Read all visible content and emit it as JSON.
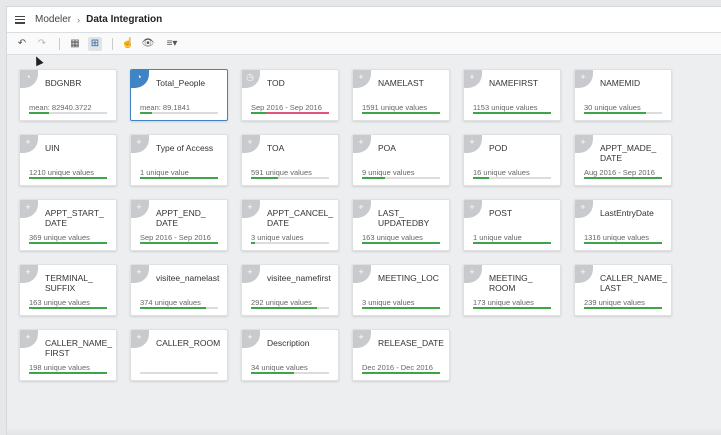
{
  "header": {
    "menu_icon": "hamburger-menu-icon",
    "breadcrumb_root": "Modeler",
    "breadcrumb_separator": "›",
    "breadcrumb_current": "Data Integration"
  },
  "toolbar": {
    "buttons": [
      {
        "icon": "undo-icon",
        "glyph": "↶"
      },
      {
        "icon": "redo-icon",
        "glyph": "↷"
      },
      {
        "icon": "table-view-icon",
        "glyph": "▦"
      },
      {
        "icon": "grid-view-icon",
        "glyph": "⊞"
      },
      {
        "icon": "join-hand-icon",
        "glyph": "☝"
      },
      {
        "icon": "eye-preview-icon",
        "glyph": "👁"
      },
      {
        "icon": "sort-list-icon",
        "glyph": "≡▾"
      }
    ]
  },
  "colors": {
    "accent": "#3f85c6",
    "bar_green": "#3da547",
    "bar_pink": "#e2547d"
  },
  "cards": [
    {
      "name": "BDGNBR",
      "stat": "mean: 82940.3722",
      "icon": "numeric-gauge-icon",
      "glyph": "◔",
      "fill": 0.25,
      "bar": "green"
    },
    {
      "name": "Total_People",
      "stat": "mean: 89.1841",
      "icon": "numeric-gauge-icon",
      "glyph": "◔",
      "fill": 0.15,
      "bar": "green",
      "selected": true
    },
    {
      "name": "TOD",
      "stat": "Sep 2016 - Sep 2016",
      "icon": "clock-icon",
      "glyph": "◷",
      "fill": 1.0,
      "bar": "mixed"
    },
    {
      "name": "NAMELAST",
      "stat": "1591 unique values",
      "icon": "text-field-icon",
      "glyph": "+",
      "fill": 1.0,
      "bar": "green"
    },
    {
      "name": "NAMEFIRST",
      "stat": "1153 unique values",
      "icon": "text-field-icon",
      "glyph": "+",
      "fill": 1.0,
      "bar": "green"
    },
    {
      "name": "NAMEMID",
      "stat": "30 unique values",
      "icon": "text-field-icon",
      "glyph": "+",
      "fill": 0.8,
      "bar": "green"
    },
    {
      "name": "UIN",
      "stat": "1210 unique values",
      "icon": "text-field-icon",
      "glyph": "+",
      "fill": 1.0,
      "bar": "green"
    },
    {
      "name": "Type of Access",
      "stat": "1 unique value",
      "icon": "text-field-icon",
      "glyph": "+",
      "fill": 1.0,
      "bar": "green"
    },
    {
      "name": "TOA",
      "stat": "591 unique values",
      "icon": "text-field-icon",
      "glyph": "+",
      "fill": 0.35,
      "bar": "green"
    },
    {
      "name": "POA",
      "stat": "9 unique values",
      "icon": "text-field-icon",
      "glyph": "+",
      "fill": 0.3,
      "bar": "green"
    },
    {
      "name": "POD",
      "stat": "16 unique values",
      "icon": "text-field-icon",
      "glyph": "+",
      "fill": 0.2,
      "bar": "green"
    },
    {
      "name": "APPT_MADE_\nDATE",
      "stat": "Aug 2016 - Sep 2016",
      "icon": "text-field-icon",
      "glyph": "+",
      "fill": 1.0,
      "bar": "green"
    },
    {
      "name": "APPT_START_\nDATE",
      "stat": "369 unique values",
      "icon": "text-field-icon",
      "glyph": "+",
      "fill": 1.0,
      "bar": "green"
    },
    {
      "name": "APPT_END_\nDATE",
      "stat": "Sep 2016 - Sep 2016",
      "icon": "text-field-icon",
      "glyph": "+",
      "fill": 1.0,
      "bar": "green"
    },
    {
      "name": "APPT_CANCEL_\nDATE",
      "stat": "3 unique values",
      "icon": "text-field-icon",
      "glyph": "+",
      "fill": 0.05,
      "bar": "green"
    },
    {
      "name": "LAST_\nUPDATEDBY",
      "stat": "163 unique values",
      "icon": "text-field-icon",
      "glyph": "+",
      "fill": 1.0,
      "bar": "green"
    },
    {
      "name": "POST",
      "stat": "1 unique value",
      "icon": "text-field-icon",
      "glyph": "+",
      "fill": 1.0,
      "bar": "green"
    },
    {
      "name": "LastEntryDate",
      "stat": "1316 unique values",
      "icon": "text-field-icon",
      "glyph": "+",
      "fill": 1.0,
      "bar": "green"
    },
    {
      "name": "TERMINAL_\nSUFFIX",
      "stat": "163 unique values",
      "icon": "text-field-icon",
      "glyph": "+",
      "fill": 1.0,
      "bar": "green"
    },
    {
      "name": "visitee_namelast",
      "stat": "374 unique values",
      "icon": "text-field-icon",
      "glyph": "+",
      "fill": 0.85,
      "bar": "green"
    },
    {
      "name": "visitee_namefirst",
      "stat": "292 unique values",
      "icon": "text-field-icon",
      "glyph": "+",
      "fill": 0.85,
      "bar": "green"
    },
    {
      "name": "MEETING_LOC",
      "stat": "3 unique values",
      "icon": "text-field-icon",
      "glyph": "+",
      "fill": 1.0,
      "bar": "green"
    },
    {
      "name": "MEETING_\nROOM",
      "stat": "173 unique values",
      "icon": "text-field-icon",
      "glyph": "+",
      "fill": 1.0,
      "bar": "green"
    },
    {
      "name": "CALLER_NAME_\nLAST",
      "stat": "239 unique values",
      "icon": "text-field-icon",
      "glyph": "+",
      "fill": 1.0,
      "bar": "green"
    },
    {
      "name": "CALLER_NAME_\nFIRST",
      "stat": "198 unique values",
      "icon": "text-field-icon",
      "glyph": "+",
      "fill": 1.0,
      "bar": "green"
    },
    {
      "name": "CALLER_ROOM",
      "stat": "",
      "icon": "text-field-icon",
      "glyph": "+",
      "fill": 0.0,
      "bar": "none"
    },
    {
      "name": "Description",
      "stat": "34 unique values",
      "icon": "text-field-icon",
      "glyph": "+",
      "fill": 0.55,
      "bar": "green"
    },
    {
      "name": "RELEASE_DATE",
      "stat": "Dec 2016 - Dec 2016",
      "icon": "text-field-icon",
      "glyph": "+",
      "fill": 1.0,
      "bar": "green"
    }
  ]
}
